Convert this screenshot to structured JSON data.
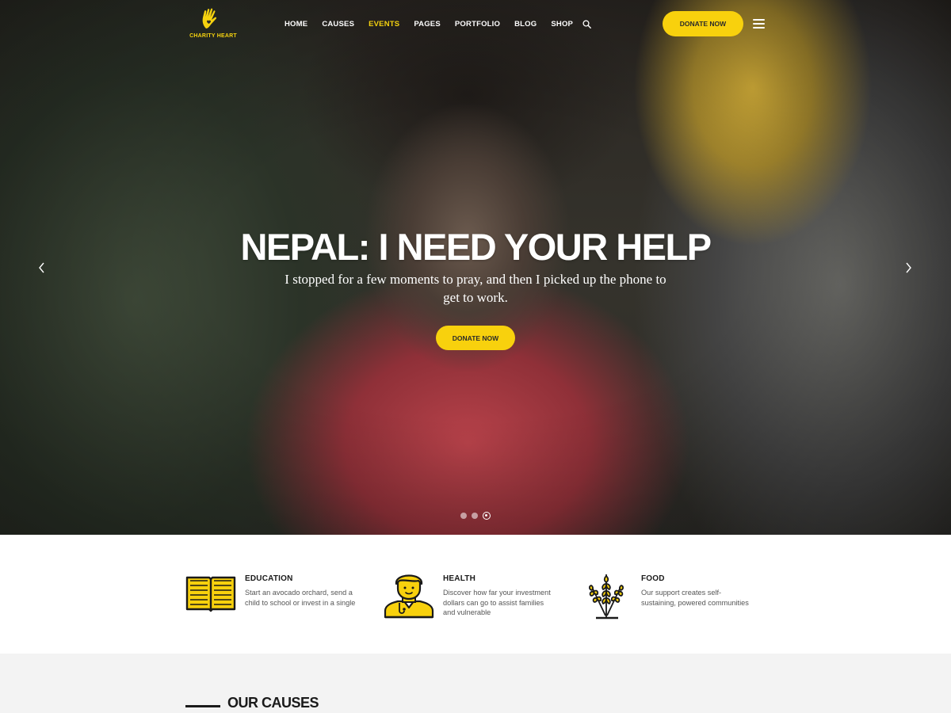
{
  "brand": {
    "name": "CHARITY HEART",
    "accent": "#f8d10d"
  },
  "nav": {
    "items": [
      {
        "label": "HOME",
        "active": false
      },
      {
        "label": "CAUSES",
        "active": false
      },
      {
        "label": "EVENTS",
        "active": true
      },
      {
        "label": "PAGES",
        "active": false
      },
      {
        "label": "PORTFOLIO",
        "active": false
      },
      {
        "label": "BLOG",
        "active": false
      },
      {
        "label": "SHOP",
        "active": false
      }
    ],
    "search_icon": "search-icon",
    "donate_label": "DONATE NOW",
    "menu_icon": "hamburger-icon"
  },
  "hero": {
    "title": "NEPAL: I NEED YOUR HELP",
    "subtitle": "I stopped for a few moments to pray, and then I picked up the phone to get to work.",
    "donate_label": "DONATE NOW",
    "slide_count": 3,
    "active_slide": 3
  },
  "features": [
    {
      "title": "EDUCATION",
      "text": "Start an avocado orchard, send a child to school or invest in a single",
      "icon": "book-icon"
    },
    {
      "title": "HEALTH",
      "text": "Discover how far your investment dollars can go to assist families and vulnerable",
      "icon": "doctor-icon"
    },
    {
      "title": "FOOD",
      "text": "Our support creates self-sustaining, powered communities",
      "icon": "wheat-icon"
    }
  ],
  "causes": {
    "title": "OUR CAUSES"
  }
}
